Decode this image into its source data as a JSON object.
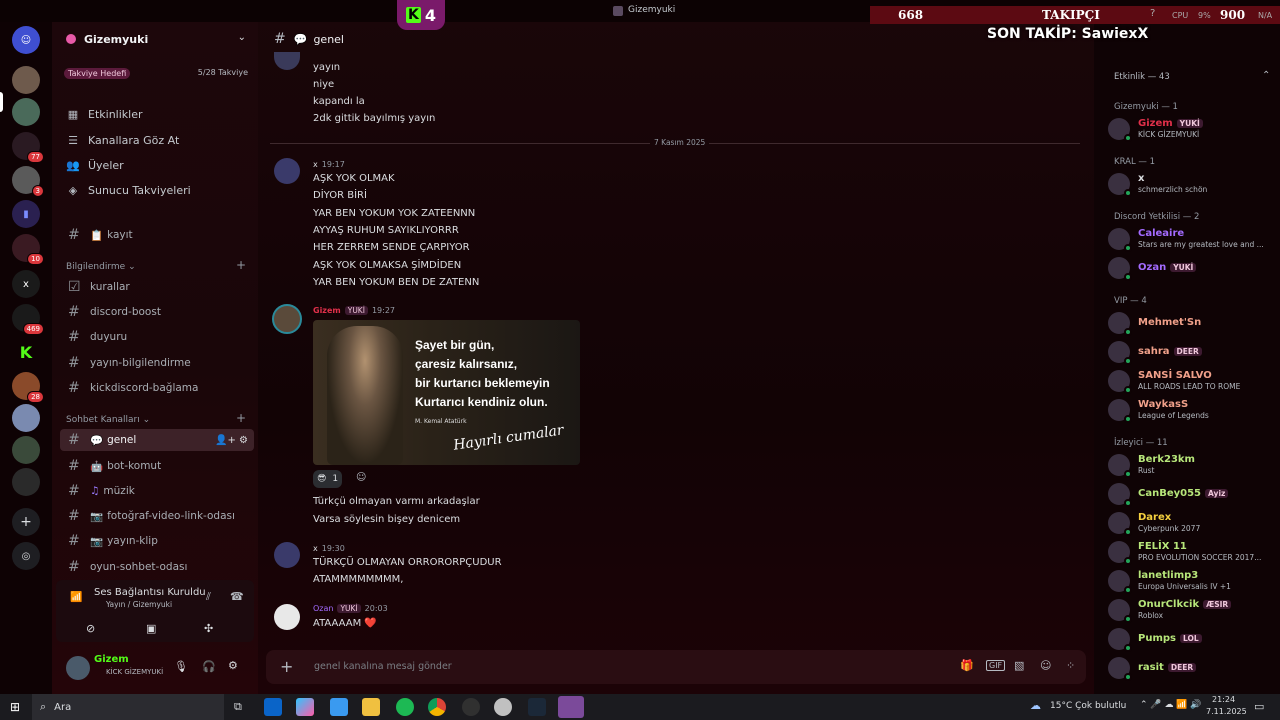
{
  "window": {
    "title": "Gizemyuki"
  },
  "overlay": {
    "kick_count": "4",
    "followers": "668",
    "followers_label": "TAKIPÇI",
    "goal": "900",
    "last_follow": "SON TAKİP: SawiexX",
    "cpu_label": "CPU",
    "cpu_value": "9%",
    "na": "N/A"
  },
  "server": {
    "name": "Gizemyuki",
    "boost_goal": "Takviye Hedefi",
    "boost_count": "5/28 Takviye"
  },
  "server_nav": [
    "Etkinlikler",
    "Kanallara Göz At",
    "Üyeler",
    "Sunucu Takviyeleri"
  ],
  "top_channel": "kayıt",
  "categories": {
    "info": "Bilgilendirme",
    "chat": "Sohbet Kanalları"
  },
  "info_channels": [
    "kurallar",
    "discord-boost",
    "duyuru",
    "yayın-bilgilendirme",
    "kickdiscord-bağlama"
  ],
  "chat_channels": [
    "genel",
    "bot-komut",
    "müzik",
    "fotoğraf-video-link-odası",
    "yayın-klip",
    "oyun-sohbet-odası"
  ],
  "rail_badges": [
    "77",
    "3",
    "10",
    "469",
    "28"
  ],
  "rail_letter": "x",
  "voice": {
    "status": "Ses Bağlantısı Kuruldu",
    "location": "Yayın / Gizemyuki"
  },
  "user": {
    "name": "Gizem",
    "status": "KİCK GİZEMYUKİ"
  },
  "chat_header": {
    "channel": "genel"
  },
  "messages_top": [
    "yayın",
    "niye",
    "kapandı la",
    "2dk gittik bayılmış yayın"
  ],
  "date_divider": "7 Kasım 2025",
  "msg1": {
    "author": "x",
    "time": "19:17",
    "lines": [
      "AŞK YOK OLMAK",
      "DİYOR BİRİ",
      "YAR BEN YOKUM YOK ZATEENNN",
      "AYYAŞ RUHUM  SAYIKLIYORRR",
      "HER ZERREM SENDE ÇARPIYOR",
      "AŞK YOK OLMAKSA ŞİMDİDEN",
      "YAR BEN YOKUM BEN DE ZATENN"
    ]
  },
  "msg2": {
    "author": "Gizem",
    "tag": "YUKİ",
    "time": "19:27",
    "image_lines": [
      "Şayet bir gün,",
      "çaresiz kalırsanız,",
      "bir kurtarıcı beklemeyin",
      "Kurtarıcı kendiniz olun."
    ],
    "image_sign": "M. Kemal Atatürk",
    "image_script": "Hayırlı cumalar",
    "reaction_count": "1",
    "lines": [
      "Türkçü olmayan varmı arkadaşlar",
      "Varsa söylesin bişey denicem"
    ]
  },
  "msg3": {
    "author": "x",
    "time": "19:30",
    "lines": [
      "TÜRKÇÜ OLMAYAN ORRORORPÇUDUR",
      "ATAMMMMMMMM,"
    ]
  },
  "msg4": {
    "author": "Ozan",
    "tag": "YUKİ",
    "time": "20:03",
    "lines": [
      "ATAAAAM ❤️"
    ]
  },
  "composer": {
    "placeholder": "genel kanalına mesaj gönder"
  },
  "members": {
    "activity": "Etkinlik — 43",
    "groups": [
      {
        "label": "Gizemyuki — 1",
        "items": [
          {
            "name": "Gizem",
            "tag": "YUKİ",
            "sub": "KİCK GİZEMYUKİ",
            "color": "#e0304a"
          }
        ]
      },
      {
        "label": "KRAL — 1",
        "items": [
          {
            "name": "x",
            "sub": "schmerzlich schön",
            "color": "#dbdee1"
          }
        ]
      },
      {
        "label": "Discord Yetkilisi — 2",
        "items": [
          {
            "name": "Caleaire",
            "sub": "Stars are my greatest love and ...",
            "color": "#a36bff"
          },
          {
            "name": "Ozan",
            "tag": "YUKİ",
            "sub": "",
            "color": "#a36bff"
          }
        ]
      },
      {
        "label": "VIP — 4",
        "items": [
          {
            "name": "Mehmet'Sn",
            "sub": "",
            "color": "#f0a08a"
          },
          {
            "name": "sahra",
            "tag": "DEER",
            "sub": "",
            "color": "#f0a08a"
          },
          {
            "name": "SANSİ SALVO",
            "sub": "ALL ROADS LEAD TO ROME",
            "color": "#f0a08a"
          },
          {
            "name": "WaykasS",
            "sub": "League of Legends",
            "color": "#f0a08a"
          }
        ]
      },
      {
        "label": "İzleyici — 11",
        "items": [
          {
            "name": "Berk23km",
            "sub": "Rust",
            "color": "#b7e67a"
          },
          {
            "name": "CanBey055",
            "tag": "Ayiz",
            "sub": "",
            "color": "#b7e67a"
          },
          {
            "name": "Darex",
            "sub": "Cyberpunk 2077",
            "color": "#f4d03f"
          },
          {
            "name": "FELİX 11",
            "sub": "PRO EVOLUTION SOCCER 2017...",
            "color": "#b7e67a"
          },
          {
            "name": "lanetlimp3",
            "sub": "Europa Universalis IV +1",
            "color": "#b7e67a"
          },
          {
            "name": "OnurClkcik",
            "tag": "ÆSIR",
            "sub": "Roblox",
            "color": "#b7e67a"
          },
          {
            "name": "Pumps",
            "tag": "LOL",
            "sub": "",
            "color": "#b7e67a"
          },
          {
            "name": "rasit",
            "tag": "DEER",
            "sub": "",
            "color": "#b7e67a"
          }
        ]
      }
    ]
  },
  "taskbar": {
    "search": "Ara",
    "weather": "15°C  Çok bulutlu",
    "time": "21:24",
    "date": "7.11.2025"
  }
}
